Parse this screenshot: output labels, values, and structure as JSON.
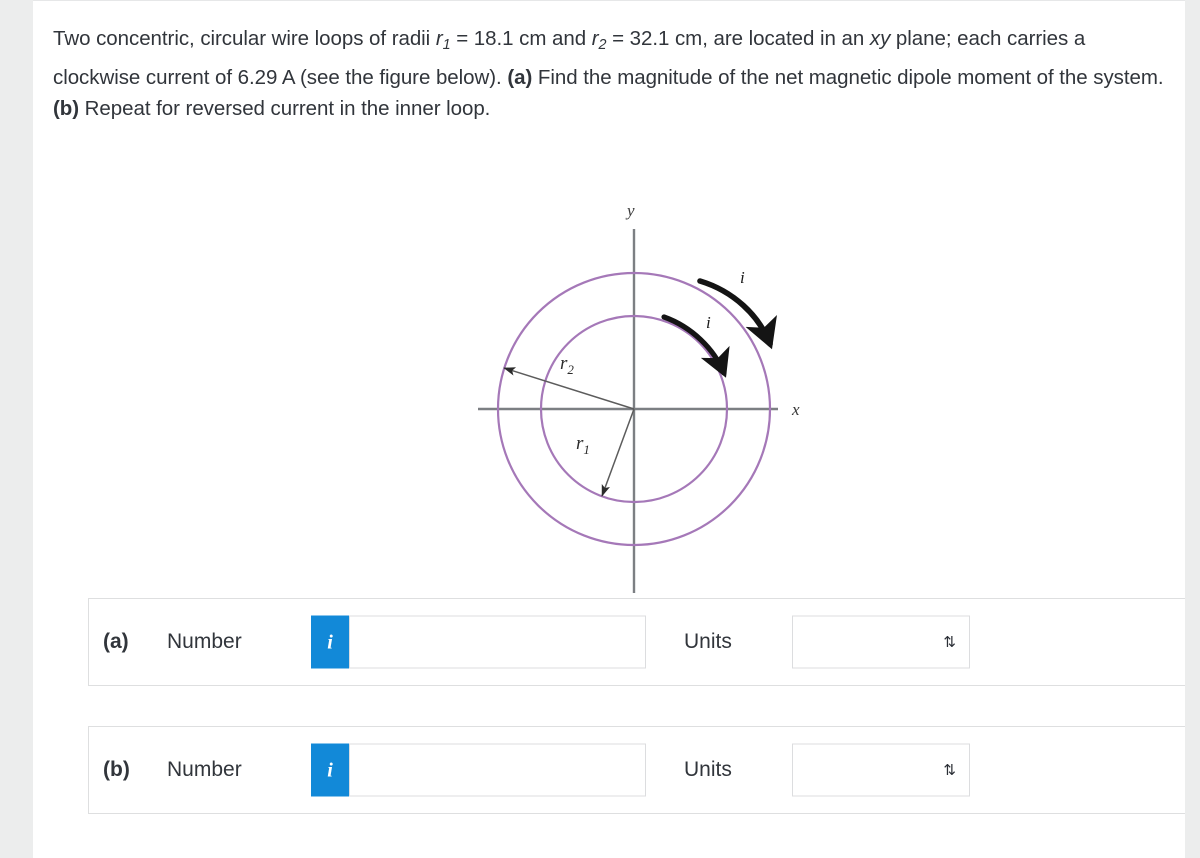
{
  "problem": {
    "segments": [
      {
        "t": "Two concentric, circular wire loops of radii ",
        "style": "normal"
      },
      {
        "t": "r",
        "style": "italic"
      },
      {
        "t": "1",
        "style": "sub"
      },
      {
        "t": " = 18.1 cm and ",
        "style": "normal"
      },
      {
        "t": "r",
        "style": "italic"
      },
      {
        "t": "2",
        "style": "sub"
      },
      {
        "t": " = 32.1 cm, are located in an ",
        "style": "normal"
      },
      {
        "t": "xy",
        "style": "italic"
      },
      {
        "t": " plane; each carries a clockwise current of 6.29 A (see the figure below). ",
        "style": "normal"
      },
      {
        "t": "(a)",
        "style": "bold"
      },
      {
        "t": " Find the magnitude of the net magnetic dipole moment of the system. ",
        "style": "normal"
      },
      {
        "t": "(b)",
        "style": "bold"
      },
      {
        "t": " Repeat for reversed current in the inner loop.",
        "style": "normal"
      }
    ],
    "radius_1_value": "18.1 cm",
    "radius_2_value": "32.1 cm",
    "current_value": "6.29 A",
    "plane": "xy",
    "current_direction": "clockwise"
  },
  "figure": {
    "axis_label_x": "x",
    "axis_label_y": "y",
    "radius_label_inner": "r",
    "radius_label_inner_sub": "1",
    "radius_label_outer": "r",
    "radius_label_outer_sub": "2",
    "current_label_inner": "i",
    "current_label_outer": "i",
    "loop_color": "#a578b8",
    "axis_color": "#7c7f83",
    "arrow_color": "#1a1a1a",
    "inner_radius_px": 93,
    "outer_radius_px": 136
  },
  "answers": [
    {
      "id": "a",
      "part_label": "(a)",
      "number_label": "Number",
      "info_icon": "i",
      "number_value": "",
      "number_placeholder": "",
      "units_label": "Units",
      "units_value": "",
      "units_chevron": "⇅"
    },
    {
      "id": "b",
      "part_label": "(b)",
      "number_label": "Number",
      "info_icon": "i",
      "number_value": "",
      "number_placeholder": "",
      "units_label": "Units",
      "units_value": "",
      "units_chevron": "⇅"
    }
  ],
  "colors": {
    "accent_blue": "#1289d8",
    "text": "#31353b",
    "page_background": "#ffffff",
    "outer_background": "#eceded",
    "border": "#dedfe0"
  }
}
